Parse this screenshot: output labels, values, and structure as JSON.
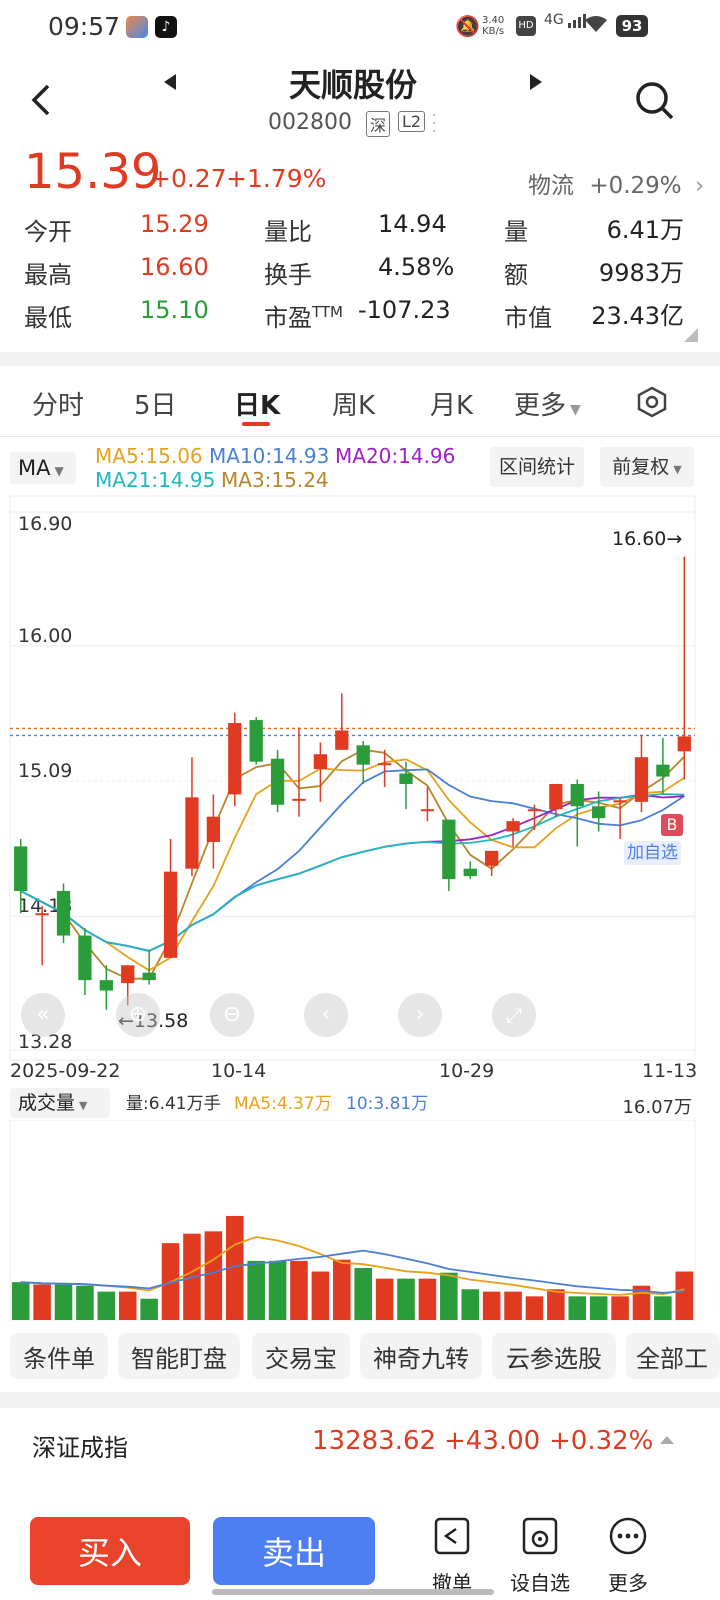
{
  "status_bar": {
    "time": "09:57",
    "net_speed_top": "3.40",
    "net_speed_unit": "KB/s",
    "signal": "4G",
    "battery": "93"
  },
  "header": {
    "title": "天顺股份",
    "code": "002800",
    "market_badge": "深",
    "level_badge": "L2"
  },
  "quote": {
    "price": "15.39",
    "change": "+0.27",
    "change_pct": "+1.79%",
    "sector_name": "物流",
    "sector_pct": "+0.29%"
  },
  "stats": {
    "open_label": "今开",
    "open": "15.29",
    "high_label": "最高",
    "high": "16.60",
    "low_label": "最低",
    "low": "15.10",
    "vol_ratio_label": "量比",
    "vol_ratio": "14.94",
    "turnover_label": "换手",
    "turnover": "4.58%",
    "pe_label": "市盈",
    "pe_sup": "TTM",
    "pe": "-107.23",
    "volume_label": "量",
    "volume": "6.41万",
    "amount_label": "额",
    "amount": "9983万",
    "mcap_label": "市值",
    "mcap": "23.43亿"
  },
  "tabs": [
    "分时",
    "5日",
    "日K",
    "周K",
    "月K",
    "更多"
  ],
  "active_tab": "日K",
  "ma_bar": {
    "selector": "MA",
    "ma5": "MA5:15.06",
    "ma10": "MA10:14.93",
    "ma20": "MA20:14.96",
    "ma21": "MA21:14.95",
    "ma3": "MA3:15.24",
    "range_stats": "区间统计",
    "adjust": "前复权"
  },
  "price_axis": [
    "16.90",
    "16.00",
    "15.09",
    "14.18",
    "13.28"
  ],
  "annotations": {
    "high_mark": "16.60",
    "low_mark": "13.58",
    "buy_marker": "B",
    "add_watch": "加自选"
  },
  "date_axis": [
    "2025-09-22",
    "10-14",
    "10-29",
    "11-13"
  ],
  "volume_bar": {
    "selector": "成交量",
    "volume": "量:6.41万手",
    "ma5": "MA5:4.37万",
    "ma10": "10:3.81万",
    "max": "16.07万"
  },
  "chips": [
    "条件单",
    "智能盯盘",
    "交易宝",
    "神奇九转",
    "云参选股",
    "全部工"
  ],
  "index_bar": {
    "name": "深证成指",
    "value": "13283.62",
    "change": "+43.00",
    "change_pct": "+0.32%"
  },
  "actions": {
    "buy": "买入",
    "sell": "卖出",
    "cancel": "撤单",
    "watch": "设自选",
    "more": "更多"
  },
  "colors": {
    "up": "#e03a20",
    "down": "#2a9d3a",
    "ma5": "#e8a11b",
    "ma10": "#4a7fd6",
    "ma20": "#a020c8",
    "ma21": "#20b8c0",
    "ma3": "#b8862a",
    "buy_btn": "#e9432b",
    "sell_btn": "#4d7ff2"
  },
  "chart_data": {
    "type": "candlestick",
    "categories_note_visible": [
      "2025-09-22",
      "10-14",
      "10-29",
      "11-13"
    ],
    "ylim": [
      13.28,
      16.9
    ],
    "candles": [
      {
        "o": 14.65,
        "c": 14.35,
        "h": 14.7,
        "l": 14.2
      },
      {
        "o": 14.2,
        "c": 14.2,
        "h": 14.25,
        "l": 13.85
      },
      {
        "o": 14.35,
        "c": 14.05,
        "h": 14.4,
        "l": 14.0
      },
      {
        "o": 14.05,
        "c": 13.75,
        "h": 14.1,
        "l": 13.65
      },
      {
        "o": 13.75,
        "c": 13.68,
        "h": 13.85,
        "l": 13.55
      },
      {
        "o": 13.73,
        "c": 13.85,
        "h": 13.85,
        "l": 13.58
      },
      {
        "o": 13.8,
        "c": 13.75,
        "h": 13.95,
        "l": 13.72
      },
      {
        "o": 13.9,
        "c": 14.48,
        "h": 14.7,
        "l": 13.9
      },
      {
        "o": 14.5,
        "c": 14.98,
        "h": 15.25,
        "l": 14.45
      },
      {
        "o": 14.68,
        "c": 14.85,
        "h": 15.0,
        "l": 14.5
      },
      {
        "o": 15.0,
        "c": 15.48,
        "h": 15.55,
        "l": 14.92
      },
      {
        "o": 15.5,
        "c": 15.22,
        "h": 15.52,
        "l": 15.2
      },
      {
        "o": 15.24,
        "c": 14.93,
        "h": 15.3,
        "l": 14.88
      },
      {
        "o": 14.97,
        "c": 14.97,
        "h": 15.45,
        "l": 14.85
      },
      {
        "o": 15.17,
        "c": 15.27,
        "h": 15.35,
        "l": 14.95
      },
      {
        "o": 15.3,
        "c": 15.43,
        "h": 15.68,
        "l": 15.3
      },
      {
        "o": 15.33,
        "c": 15.2,
        "h": 15.36,
        "l": 15.07
      },
      {
        "o": 15.21,
        "c": 15.21,
        "h": 15.3,
        "l": 15.05
      },
      {
        "o": 15.14,
        "c": 15.07,
        "h": 15.22,
        "l": 14.9
      },
      {
        "o": 14.9,
        "c": 14.9,
        "h": 15.05,
        "l": 14.82
      },
      {
        "o": 14.83,
        "c": 14.43,
        "h": 14.83,
        "l": 14.35
      },
      {
        "o": 14.5,
        "c": 14.45,
        "h": 14.55,
        "l": 14.43
      },
      {
        "o": 14.52,
        "c": 14.62,
        "h": 14.6,
        "l": 14.45
      },
      {
        "o": 14.75,
        "c": 14.82,
        "h": 14.84,
        "l": 14.65
      },
      {
        "o": 14.9,
        "c": 14.9,
        "h": 14.93,
        "l": 14.76
      },
      {
        "o": 14.9,
        "c": 15.07,
        "h": 15.07,
        "l": 14.85
      },
      {
        "o": 15.07,
        "c": 14.92,
        "h": 15.1,
        "l": 14.65
      },
      {
        "o": 14.92,
        "c": 14.84,
        "h": 15.02,
        "l": 14.75
      },
      {
        "o": 14.96,
        "c": 14.96,
        "h": 14.98,
        "l": 14.7
      },
      {
        "o": 14.95,
        "c": 15.25,
        "h": 15.4,
        "l": 14.88
      },
      {
        "o": 15.2,
        "c": 15.12,
        "h": 15.38,
        "l": 15.0
      },
      {
        "o": 15.29,
        "c": 15.39,
        "h": 16.6,
        "l": 15.1
      }
    ],
    "volume": [
      3.2,
      3.0,
      3.0,
      2.9,
      2.4,
      2.4,
      1.8,
      6.5,
      7.3,
      7.5,
      8.8,
      5.0,
      5.0,
      5.0,
      4.1,
      5.1,
      4.4,
      3.5,
      3.5,
      3.5,
      4.0,
      2.6,
      2.4,
      2.4,
      2.0,
      2.6,
      2.0,
      2.0,
      2.0,
      2.9,
      2.0,
      4.1
    ]
  }
}
